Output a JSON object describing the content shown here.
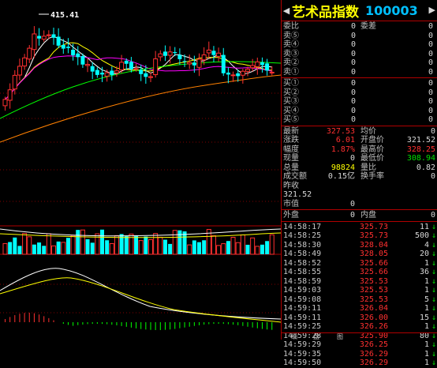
{
  "chart": {
    "high_label": "415.41",
    "colors": {
      "up": "#ff3030",
      "down": "#00ffff",
      "ma5": "#ffffff",
      "ma10": "#ffff00",
      "ma20": "#ff00ff",
      "ma60": "#00ff00",
      "ma120": "#ff8000",
      "grid": "#800000"
    }
  },
  "header": {
    "left_arrow": "◀",
    "name": "艺术品指数",
    "code": "100003",
    "right_arrow": "▶"
  },
  "orders": [
    {
      "label": "委比",
      "value": "0",
      "label2": "委差",
      "value2": "0"
    },
    {
      "label": "卖⑤",
      "value": "0",
      "value2": "0"
    },
    {
      "label": "卖④",
      "value": "0",
      "value2": "0"
    },
    {
      "label": "卖③",
      "value": "0",
      "value2": "0"
    },
    {
      "label": "卖②",
      "value": "0",
      "value2": "0"
    },
    {
      "label": "卖①",
      "value": "0",
      "value2": "0"
    }
  ],
  "bids": [
    {
      "label": "买①",
      "value": "0",
      "value2": "0"
    },
    {
      "label": "买②",
      "value": "0",
      "value2": "0"
    },
    {
      "label": "买③",
      "value": "0",
      "value2": "0"
    },
    {
      "label": "买④",
      "value": "0",
      "value2": "0"
    },
    {
      "label": "买⑤",
      "value": "0",
      "value2": "0"
    }
  ],
  "quote": {
    "latest_label": "最新",
    "latest": "327.53",
    "avg_label": "均价",
    "avg": "0",
    "change_label": "涨跌",
    "change": "6.01",
    "open_label": "开盘价",
    "open": "321.52",
    "pct_label": "幅度",
    "pct": "1.87%",
    "high_label": "最高价",
    "high": "328.25",
    "cur_vol_label": "现量",
    "cur_vol": "0",
    "low_label": "最低价",
    "low": "308.94",
    "total_vol_label": "总量",
    "total_vol": "98824",
    "ratio_label": "量比",
    "ratio": "0.82",
    "amount_label": "成交额",
    "amount": "0.15亿",
    "turnover_label": "换手率",
    "turnover": "0",
    "prev_label": "昨收",
    "prev": "321.52",
    "mcap_label": "市值",
    "mcap": "0",
    "outer_label": "外盘",
    "outer": "0",
    "inner_label": "内盘",
    "inner": "0"
  },
  "ticks": [
    {
      "time": "14:58:17",
      "price": "325.73",
      "vol": "11"
    },
    {
      "time": "14:58:25",
      "price": "325.73",
      "vol": "500"
    },
    {
      "time": "14:58:30",
      "price": "328.04",
      "vol": "4"
    },
    {
      "time": "14:58:49",
      "price": "328.05",
      "vol": "20"
    },
    {
      "time": "14:58:52",
      "price": "325.66",
      "vol": "1"
    },
    {
      "time": "14:58:55",
      "price": "325.66",
      "vol": "36"
    },
    {
      "time": "14:58:59",
      "price": "325.53",
      "vol": "1"
    },
    {
      "time": "14:59:03",
      "price": "325.53",
      "vol": "1"
    },
    {
      "time": "14:59:08",
      "price": "325.53",
      "vol": "5"
    },
    {
      "time": "14:59:11",
      "price": "326.04",
      "vol": "1"
    },
    {
      "time": "14:59:11",
      "price": "326.00",
      "vol": "15"
    },
    {
      "time": "14:59:25",
      "price": "326.26",
      "vol": "1"
    },
    {
      "time": "14:59:28",
      "price": "325.90",
      "vol": "80"
    },
    {
      "time": "14:59:29",
      "price": "326.25",
      "vol": "1"
    },
    {
      "time": "14:59:35",
      "price": "326.29",
      "vol": "1"
    },
    {
      "time": "14:59:50",
      "price": "326.29",
      "vol": "1"
    }
  ],
  "tick_arrow": "↓",
  "tabs": [
    "细",
    "盘",
    "图"
  ]
}
